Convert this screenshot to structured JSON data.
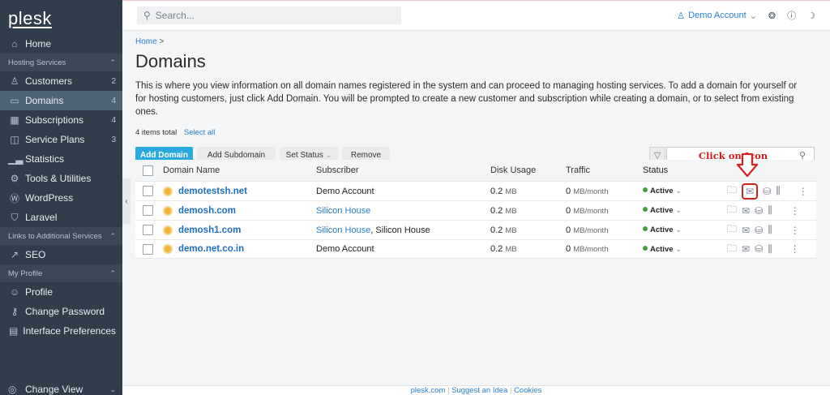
{
  "app": {
    "logo": "plesk"
  },
  "sidebar": {
    "items": [
      {
        "type": "item",
        "icon": "home-icon",
        "glyph": "⌂",
        "label": "Home",
        "count": ""
      },
      {
        "type": "section",
        "label": "Hosting Services"
      },
      {
        "type": "item",
        "icon": "customers-icon",
        "glyph": "♙",
        "label": "Customers",
        "count": "2"
      },
      {
        "type": "item",
        "icon": "domains-icon",
        "glyph": "▭",
        "label": "Domains",
        "count": "4",
        "active": true
      },
      {
        "type": "item",
        "icon": "subscriptions-icon",
        "glyph": "▦",
        "label": "Subscriptions",
        "count": "4"
      },
      {
        "type": "item",
        "icon": "service-plans-icon",
        "glyph": "◫",
        "label": "Service Plans",
        "count": "3"
      },
      {
        "type": "item",
        "icon": "statistics-icon",
        "glyph": "▁▃",
        "label": "Statistics",
        "count": ""
      },
      {
        "type": "item",
        "icon": "tools-icon",
        "glyph": "⚙",
        "label": "Tools & Utilities",
        "count": ""
      },
      {
        "type": "item",
        "icon": "wordpress-icon",
        "glyph": "Ⓦ",
        "label": "WordPress",
        "count": ""
      },
      {
        "type": "item",
        "icon": "laravel-icon",
        "glyph": "⛉",
        "label": "Laravel",
        "count": ""
      },
      {
        "type": "section",
        "label": "Links to Additional Services"
      },
      {
        "type": "item",
        "icon": "seo-icon",
        "glyph": "↗",
        "label": "SEO",
        "count": ""
      },
      {
        "type": "section",
        "label": "My Profile"
      },
      {
        "type": "item",
        "icon": "profile-icon",
        "glyph": "☺",
        "label": "Profile",
        "count": ""
      },
      {
        "type": "item",
        "icon": "key-icon",
        "glyph": "⚷",
        "label": "Change Password",
        "count": ""
      },
      {
        "type": "item",
        "icon": "preferences-icon",
        "glyph": "▤",
        "label": "Interface Preferences",
        "count": ""
      }
    ],
    "bottom_label": "Change View"
  },
  "topbar": {
    "search_placeholder": "Search...",
    "account_label": "Demo Account"
  },
  "page": {
    "breadcrumb": "Home",
    "title": "Domains",
    "description": "This is where you view information on all domain names registered in the system and can proceed to managing hosting services. To add a domain for yourself or for hosting customers, just click Add Domain. You will be prompted to create a new customer and subscription while creating a domain, or to select from existing ones.",
    "items_total": "4 items total",
    "select_all": "Select all"
  },
  "toolbar": {
    "add_domain": "Add Domain",
    "add_subdomain": "Add Subdomain",
    "set_status": "Set Status",
    "remove": "Remove",
    "search_hint": "Click on Icon"
  },
  "table": {
    "columns": [
      "Domain Name",
      "Subscriber",
      "Disk Usage",
      "Traffic",
      "Status"
    ],
    "rows": [
      {
        "domain": "demotestsh.net",
        "subscriber": [
          {
            "text": "Demo Account",
            "link": false
          }
        ],
        "disk": "0.2",
        "disk_unit": "MB",
        "traffic": "0",
        "traffic_unit": "MB/month",
        "status": "Active"
      },
      {
        "domain": "demosh.com",
        "subscriber": [
          {
            "text": "Silicon House",
            "link": true
          }
        ],
        "disk": "0.2",
        "disk_unit": "MB",
        "traffic": "0",
        "traffic_unit": "MB/month",
        "status": "Active"
      },
      {
        "domain": "demosh1.com",
        "subscriber": [
          {
            "text": "Silicon House",
            "link": true
          },
          {
            "text": ", Silicon House",
            "link": false
          }
        ],
        "disk": "0.2",
        "disk_unit": "MB",
        "traffic": "0",
        "traffic_unit": "MB/month",
        "status": "Active"
      },
      {
        "domain": "demo.net.co.in",
        "subscriber": [
          {
            "text": "Demo Account",
            "link": false
          }
        ],
        "disk": "0.2",
        "disk_unit": "MB",
        "traffic": "0",
        "traffic_unit": "MB/month",
        "status": "Active"
      }
    ]
  },
  "footer": {
    "links": [
      "plesk.com",
      "Suggest an Idea",
      "Cookies"
    ]
  },
  "colors": {
    "sidebar": "#303d4a",
    "accent": "#28aade",
    "link": "#267fd1",
    "annotation": "#d61f1f",
    "status_active": "#3ea33e"
  }
}
